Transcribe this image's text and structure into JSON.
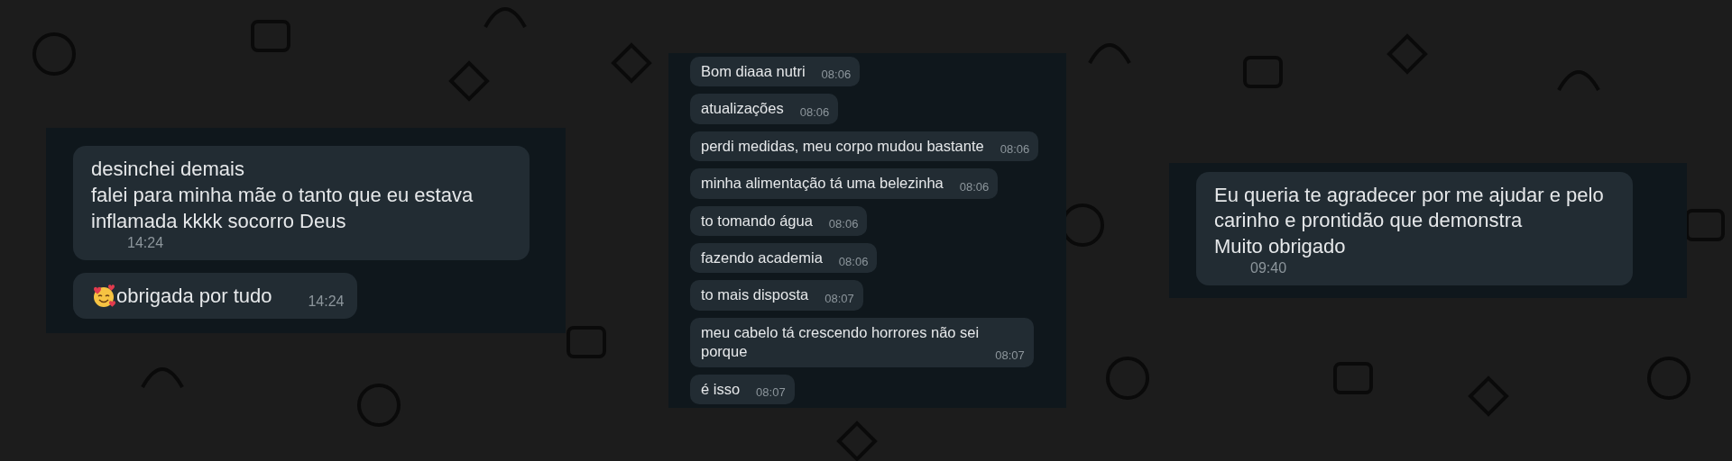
{
  "panels": [
    {
      "messages": [
        {
          "kind": "text",
          "text": "desinchei demais\nfalei para minha mãe o tanto que eu estava\ninflamada kkkk socorro Deus",
          "time": "14:24"
        },
        {
          "kind": "emoji_text",
          "text": "obrigada por tudo",
          "time": "14:24"
        }
      ]
    },
    {
      "messages": [
        {
          "kind": "text",
          "text": "Bom diaaa nutri",
          "time": "08:06"
        },
        {
          "kind": "text",
          "text": "atualizações",
          "time": "08:06"
        },
        {
          "kind": "text",
          "text": "perdi medidas, meu corpo mudou bastante",
          "time": "08:06"
        },
        {
          "kind": "text",
          "text": "minha alimentação tá uma belezinha",
          "time": "08:06"
        },
        {
          "kind": "text",
          "text": "to tomando água",
          "time": "08:06"
        },
        {
          "kind": "text",
          "text": "fazendo academia",
          "time": "08:06"
        },
        {
          "kind": "text",
          "text": "to mais disposta",
          "time": "08:07"
        },
        {
          "kind": "text",
          "text": "meu cabelo tá crescendo horrores não sei\nporque",
          "time": "08:07"
        },
        {
          "kind": "text",
          "text": "é isso",
          "time": "08:07"
        }
      ]
    },
    {
      "messages": [
        {
          "kind": "text",
          "text": "Eu queria te agradecer por me ajudar e pelo\ncarinho e prontidão que demonstra\nMuito obrigado",
          "time": "09:40"
        }
      ]
    }
  ]
}
